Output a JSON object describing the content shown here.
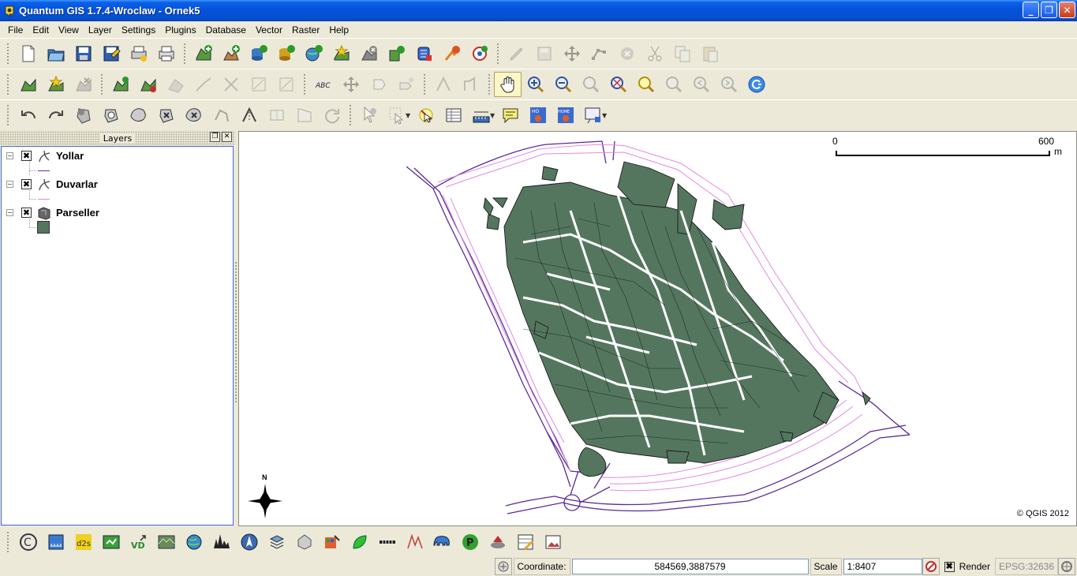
{
  "window": {
    "title": "Quantum GIS 1.7.4-Wroclaw - Ornek5",
    "controls": [
      "minimize",
      "maximize",
      "close"
    ]
  },
  "menubar": {
    "items": [
      "File",
      "Edit",
      "View",
      "Layer",
      "Settings",
      "Plugins",
      "Database",
      "Vector",
      "Raster",
      "Help"
    ]
  },
  "toolbars": {
    "file": [
      "new-project-icon",
      "open-project-icon",
      "save-project-icon",
      "save-as-icon",
      "print-composer-icon",
      "composer-manager-icon"
    ],
    "add_layers": [
      "add-vector-icon",
      "add-raster-icon",
      "add-postgis-icon",
      "add-spatialite-icon",
      "add-wms-icon",
      "new-shapefile-icon",
      "remove-layer-icon",
      "add-wfs-icon",
      "add-mssql-icon",
      "add-delimited-icon",
      "gps-icon"
    ],
    "digitizing": [
      "toggle-edit-icon",
      "save-edits-icon",
      "move-feature-icon",
      "node-tool-icon",
      "delete-selected-icon",
      "cut-features-icon",
      "copy-features-icon",
      "paste-features-icon"
    ],
    "navigation": [
      "pan-icon",
      "zoom-in-icon",
      "zoom-out-icon",
      "zoom-actual-icon",
      "zoom-full-icon",
      "zoom-selection-icon",
      "zoom-layer-icon",
      "zoom-last-icon",
      "zoom-next-icon",
      "refresh-icon"
    ],
    "advanced": [
      "undo-icon",
      "redo-icon",
      "simplify-icon",
      "add-ring-icon",
      "add-part-icon",
      "delete-ring-icon",
      "delete-part-icon",
      "reshape-icon",
      "split-icon",
      "merge-icon",
      "merge-attributes-icon",
      "rotate-icon"
    ],
    "attributes": [
      "identify-icon",
      "select-icon",
      "deselect-icon",
      "attribute-table-icon",
      "measure-icon",
      "map-tips-icon",
      "new-bookmark-icon",
      "show-bookmarks-icon",
      "annotation-icon"
    ]
  },
  "layers_panel": {
    "title": "Layers",
    "layers": [
      {
        "name": "Yollar",
        "checked": "✖",
        "type": "line",
        "color": "#6a2aa0"
      },
      {
        "name": "Duvarlar",
        "checked": "✖",
        "type": "line",
        "color": "#d878d8"
      },
      {
        "name": "Parseller",
        "checked": "✖",
        "type": "polygon",
        "color": "#54765f"
      }
    ]
  },
  "map": {
    "scale_bar": {
      "start": "0",
      "end": "600",
      "unit": "m"
    },
    "north_label": "N",
    "copyright": "© QGIS 2012",
    "colors": {
      "parcel_fill": "#54765f",
      "road": "#5a2a9a",
      "wall": "#e28ae2"
    }
  },
  "statusbar": {
    "coordinate_label": "Coordinate:",
    "coordinate_value": "584569,3887579",
    "scale_label": "Scale",
    "scale_value": "1:8407",
    "render_label": "Render",
    "render_checked": "✖",
    "crs": "EPSG:32636"
  }
}
